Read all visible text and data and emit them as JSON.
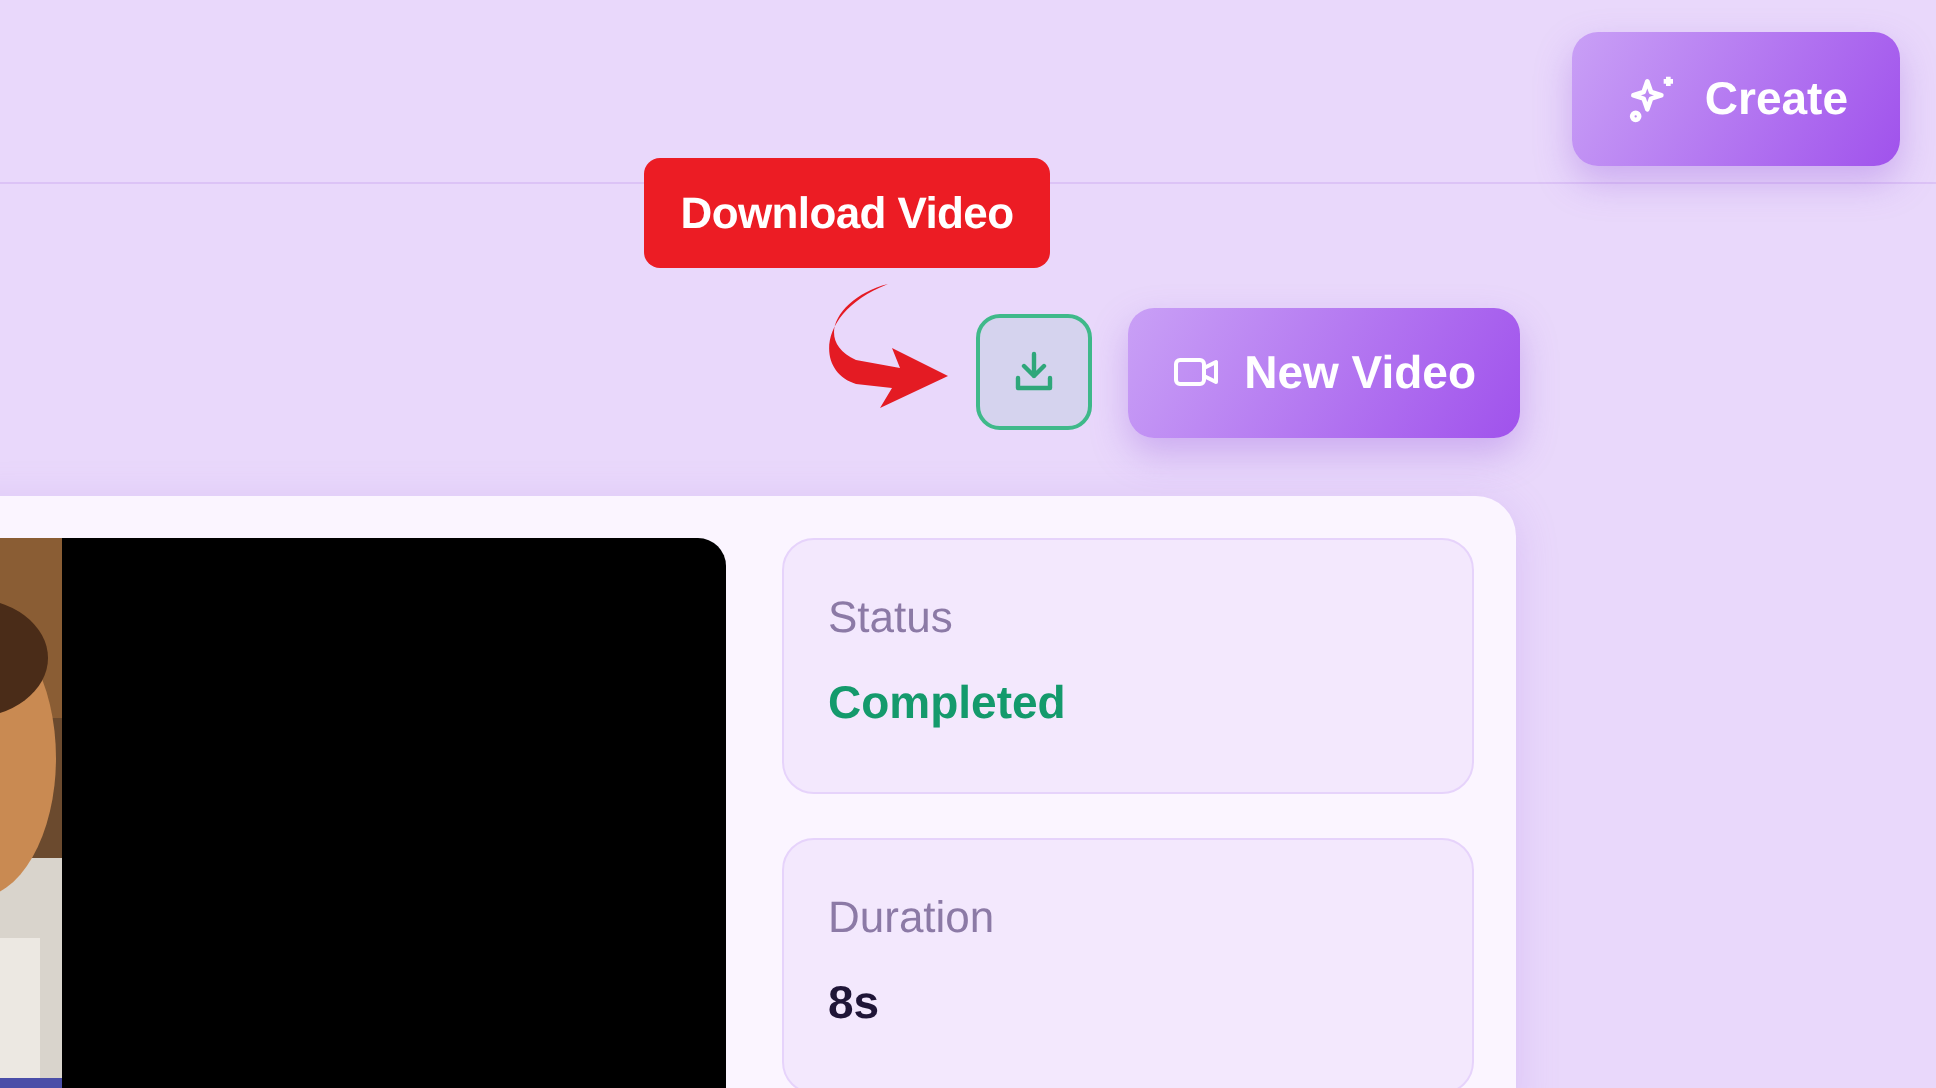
{
  "header": {
    "create_button": {
      "label": "Create"
    }
  },
  "annotation": {
    "text": "Download Video"
  },
  "toolbar": {
    "new_video_button": {
      "label": "New Video"
    }
  },
  "stats": [
    {
      "label": "Status",
      "value": "Completed",
      "kind": "success"
    },
    {
      "label": "Duration",
      "value": "8s",
      "kind": "plain"
    }
  ]
}
